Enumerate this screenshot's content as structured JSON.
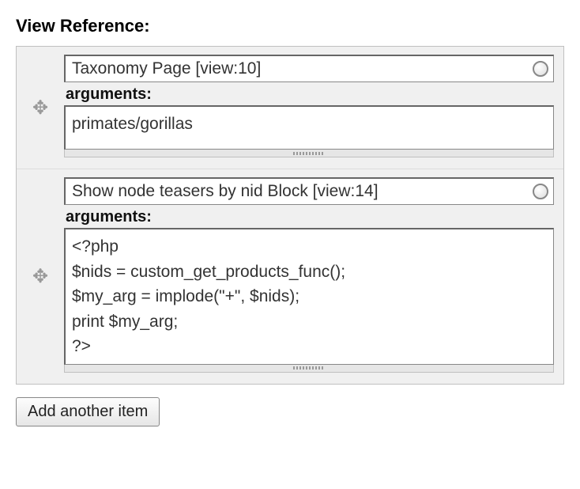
{
  "heading": "View Reference:",
  "arguments_label": "arguments:",
  "rows": [
    {
      "view_text": "Taxonomy Page [view:10]",
      "args_value": "primates/gorillas"
    },
    {
      "view_text": "Show node teasers by nid Block [view:14]",
      "args_value": "<?php\n$nids = custom_get_products_func();\n$my_arg = implode(\"+\", $nids);\nprint $my_arg;\n?>"
    }
  ],
  "add_button_label": "Add another item"
}
